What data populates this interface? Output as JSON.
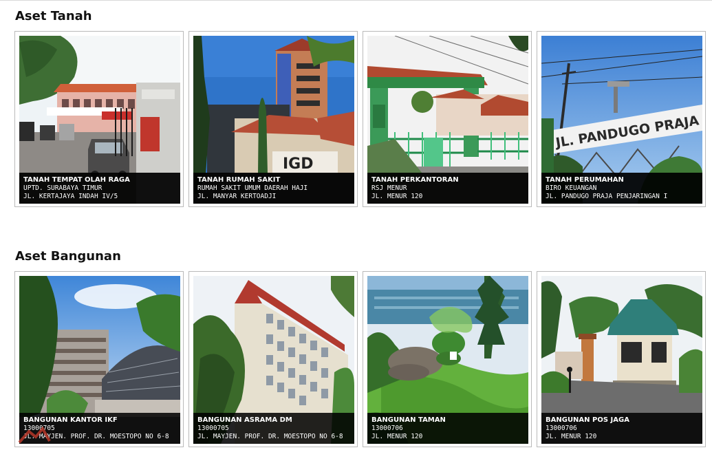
{
  "sections": [
    {
      "title": "Aset Tanah",
      "cards": [
        {
          "title": "TANAH TEMPAT OLAH RAGA",
          "line1": "UPTD. SURABAYA TIMUR",
          "line2": "JL. KERTAJAYA INDAH IV/5"
        },
        {
          "title": "TANAH RUMAH SAKIT",
          "line1": "RUMAH SAKIT UMUM DAERAH HAJI",
          "line2": "JL. MANYAR KERTOADJI"
        },
        {
          "title": "TANAH PERKANTORAN",
          "line1": "RSJ MENUR",
          "line2": "JL. MENUR 120"
        },
        {
          "title": "TANAH PERUMAHAN",
          "line1": "BIRO KEUANGAN",
          "line2": "JL. PANDUGO PRAJA PENJARINGAN I"
        }
      ]
    },
    {
      "title": "Aset Bangunan",
      "cards": [
        {
          "title": "BANGUNAN KANTOR IKF",
          "line1": "13000705",
          "line2": "JL. MAYJEN. PROF. DR. MOESTOPO NO 6-8"
        },
        {
          "title": "BANGUNAN ASRAMA DM",
          "line1": "13000705",
          "line2": "JL. MAYJEN. PROF. DR. MOESTOPO NO 6-8"
        },
        {
          "title": "BANGUNAN TAMAN",
          "line1": "13000706",
          "line2": "JL. MENUR 120"
        },
        {
          "title": "BANGUNAN POS JAGA",
          "line1": "13000706",
          "line2": "JL. MENUR 120"
        }
      ]
    }
  ],
  "photos": {
    "sign_text": "JL. PANDUGO PRAJA I",
    "igd_text": "IGD"
  },
  "colors": {
    "caption_bg": "#000000",
    "caption_text": "#ffffff",
    "card_border": "#b9b9b9",
    "watermark": "#c0392b"
  }
}
